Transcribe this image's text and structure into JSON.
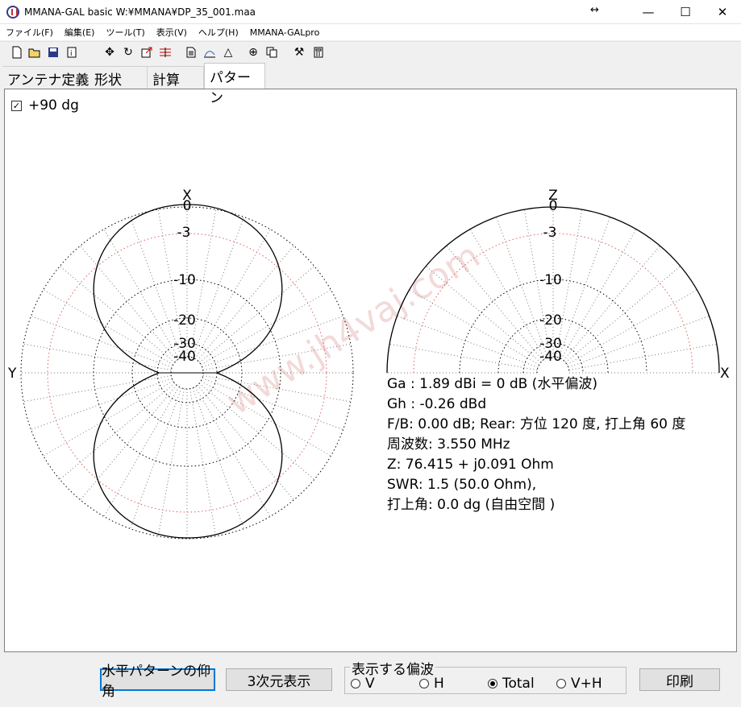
{
  "window": {
    "title": "MMANA-GAL basic  W:¥MMANA¥DP_35_001.maa",
    "resize_glyph": "↔",
    "minimize": "—",
    "maximize": "☐",
    "close": "✕"
  },
  "menu": [
    "ファイル(F)",
    "編集(E)",
    "ツール(T)",
    "表示(V)",
    "ヘルプ(H)",
    "MMANA-GALpro"
  ],
  "toolbar_icons": [
    "new-file",
    "open-folder",
    "save",
    "info",
    "move",
    "rotate",
    "export",
    "segments",
    "page",
    "pen",
    "triangle",
    "crosshair",
    "copy",
    "tools",
    "calculator"
  ],
  "tabs": [
    "アンテナ定義",
    "形状",
    "計算",
    "パターン"
  ],
  "active_tab": "パターン",
  "checkbox": {
    "label": "+90 dg",
    "checked": true
  },
  "left_plot": {
    "top_label": "X",
    "side_label": "Y",
    "ring_labels": [
      "0",
      "-3",
      "-10",
      "-20",
      "-30",
      "-40"
    ]
  },
  "right_plot": {
    "top_label": "Z",
    "side_label": "X",
    "ring_labels": [
      "0",
      "-3",
      "-10",
      "-20",
      "-30",
      "-40"
    ]
  },
  "watermark": "www.jh4vaj.com",
  "info": {
    "ga": "Ga : 1.89 dBi = 0 dB  (水平偏波)",
    "gh": "Gh : -0.26 dBd",
    "fb": "F/B: 0.00 dB; Rear: 方位 120 度,  打上角 60 度",
    "freq": "周波数: 3.550 MHz",
    "z": "Z: 76.415 + j0.091 Ohm",
    "swr": "SWR: 1.5 (50.0 Ohm),",
    "elev": "打上角: 0.0 dg (自由空間 )"
  },
  "buttons": {
    "horizontal": "水平パターンの仰角",
    "three_d": "3次元表示",
    "print": "印刷"
  },
  "polarization": {
    "title": "表示する偏波",
    "options": [
      "V",
      "H",
      "Total",
      "V+H"
    ],
    "selected": "Total"
  },
  "colors": {
    "grid_red": "#e06060",
    "grid_black": "#000000"
  }
}
